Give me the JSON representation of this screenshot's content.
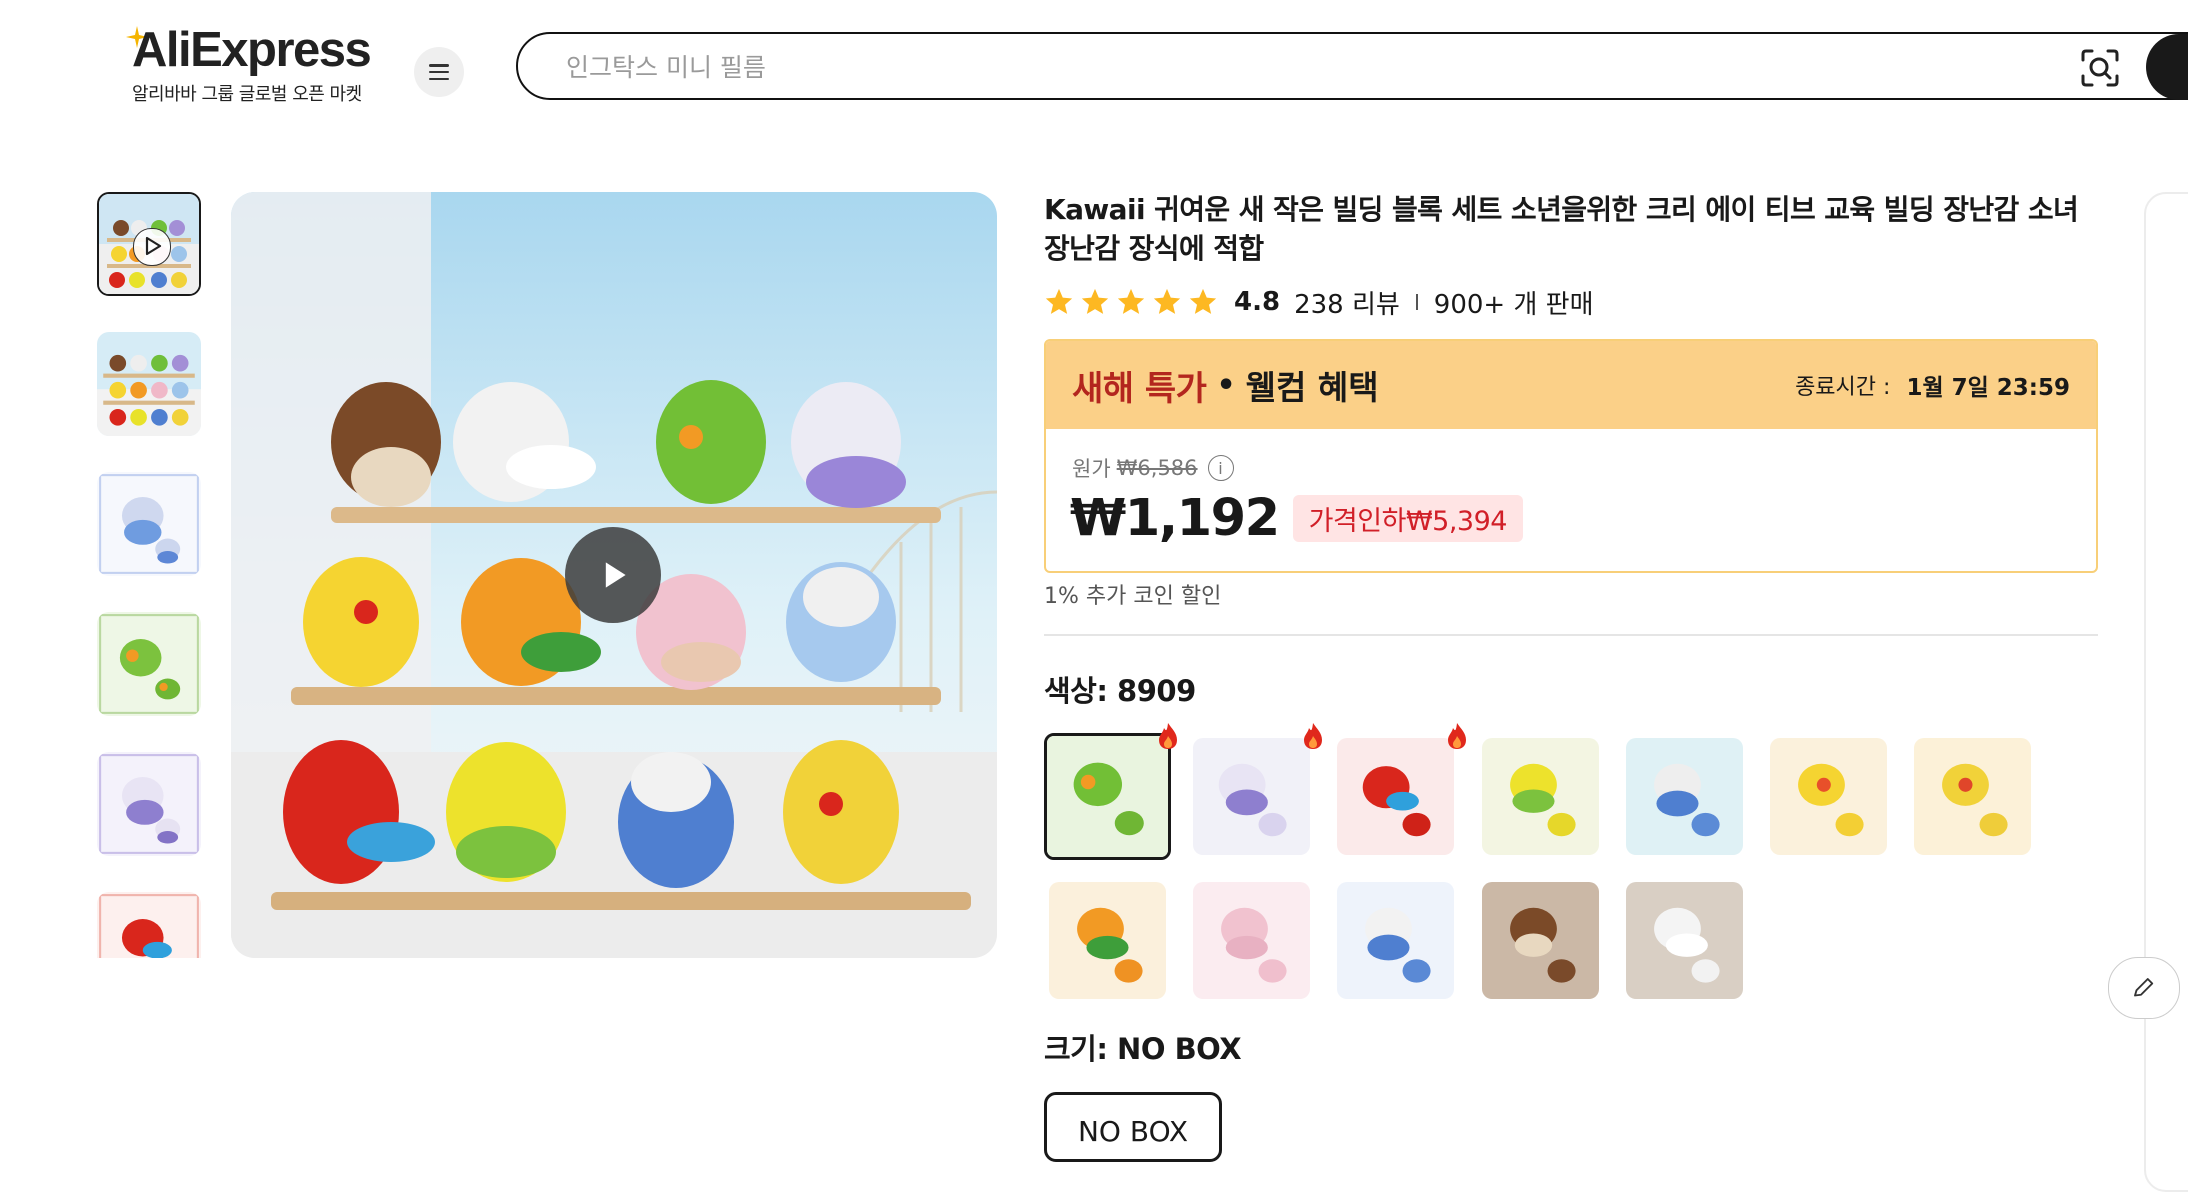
{
  "header": {
    "logo_text": "AliExpress",
    "logo_sub": "알리바바 그룹 글로벌 오픈 마켓",
    "menu_icon": "hamburger-icon",
    "search_placeholder": "인그탁스 미니 필름",
    "camera_icon": "image-search-icon"
  },
  "product": {
    "title": "Kawaii 귀여운 새 작은 빌딩 블록 세트 소년을위한 크리 에이 티브 교육 빌딩 장난감 소녀 장난감 장식에 적합",
    "rating": "4.8",
    "reviews": "238 리뷰",
    "sold": "900+ 개 판매",
    "stars_filled": 5
  },
  "promo": {
    "title": "새해 특가",
    "dot": "•",
    "subtitle": "웰컴 혜택",
    "end_label": "종료시간 :",
    "end_time": "1월 7일 23:59",
    "original_label": "원가",
    "original_price": "₩6,586",
    "price": "₩1,192",
    "discount": "가격인하₩5,394"
  },
  "coin_note": "1% 추가 코인 할인",
  "color": {
    "label": "색상: 8909",
    "selected_index": 0
  },
  "size": {
    "label": "크기: NO BOX",
    "option": "NO BOX"
  },
  "colors": {
    "accent_red": "#b3261e",
    "promo_bg": "#fbd088",
    "discount_red": "#d11f28",
    "star": "#fdb822"
  }
}
